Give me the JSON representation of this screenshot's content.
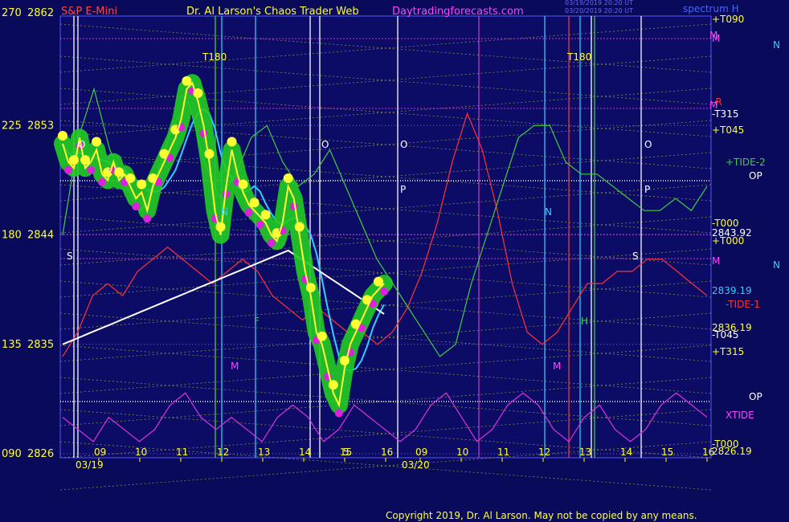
{
  "header": {
    "instrument": "S&P E-Mini",
    "title": "Dr. Al Larson's Chaos Trader Web",
    "site": "Daytradingforecasts.com",
    "stamp1": "03/19/2019 20:20 UT",
    "stamp2": "03/20/2019 20:20 UT",
    "spectrum": "spectrum H"
  },
  "footer": {
    "copyright": "Copyright 2019, Dr. Al Larson. May not be copied by any means."
  },
  "colors": {
    "bg": "#0a0a5a",
    "plot_bg": "#0c0c66",
    "price": "#ffff33",
    "green_tube": "#22cc22",
    "magenta": "#dd22dd",
    "cyan_avg": "#33ccff",
    "white_avg": "#ffffff",
    "tide1": "#ff3333",
    "tide2": "#44cc44",
    "xtide": "#dd33dd"
  },
  "chart_data": {
    "type": "line",
    "title": "S&P E-Mini",
    "left_axis_degrees": [
      "270",
      "225",
      "180",
      "135",
      "090"
    ],
    "left_axis_prices": [
      "2862",
      "2853",
      "2844",
      "2835",
      "2826"
    ],
    "ylim": [
      2826,
      2862
    ],
    "date_labels": [
      "03/19",
      "03/20"
    ],
    "hour_labels": [
      "09",
      "10",
      "11",
      "12",
      "13",
      "14",
      "15",
      "16",
      "09",
      "10",
      "11",
      "12",
      "13",
      "14",
      "15",
      "16"
    ],
    "right_labels": [
      "+T090",
      "M",
      "N",
      "-R",
      "-T315",
      "+T045",
      "+TIDE-2",
      "OP",
      "-T000",
      "2843.92",
      "+T000",
      "M",
      "N",
      "2839.19",
      "-TIDE-1",
      "2836.19",
      "-T045",
      "+T315",
      "OP",
      "XTIDE",
      "-T000",
      "2826.19"
    ],
    "annotations": [
      "T180",
      "T180",
      "O",
      "O",
      "O",
      "O",
      "P",
      "P",
      "S",
      "S",
      "N",
      "N",
      "F",
      "H",
      "M",
      "M",
      "M",
      "M",
      "5"
    ],
    "series": [
      {
        "name": "S&P E-Mini",
        "x": [
          0,
          1,
          2,
          3,
          4,
          5,
          6,
          7,
          8,
          9,
          10,
          11,
          12,
          13,
          14,
          15,
          16,
          17,
          18,
          19,
          20,
          21,
          22,
          23,
          24,
          25,
          26,
          27,
          28,
          29,
          30,
          31,
          32,
          33,
          34,
          35,
          36,
          37,
          38,
          39,
          40,
          41,
          42,
          43,
          44,
          45,
          46,
          47,
          48,
          49,
          50,
          51,
          52,
          53,
          54,
          55,
          56,
          57
        ],
        "values": [
          2851.5,
          2850,
          2849.5,
          2852,
          2849.5,
          2850,
          2851,
          2849,
          2848.5,
          2850,
          2848.5,
          2849,
          2848,
          2847,
          2847.5,
          2846,
          2848,
          2849,
          2850,
          2851,
          2852,
          2853.5,
          2856,
          2856.5,
          2855,
          2853,
          2850,
          2846,
          2844,
          2848,
          2851,
          2849,
          2847.5,
          2846.5,
          2846,
          2845.5,
          2845,
          2844,
          2843.5,
          2845,
          2848,
          2847,
          2844,
          2841,
          2839,
          2836,
          2835,
          2833,
          2831,
          2830,
          2833,
          2835,
          2836,
          2837,
          2838,
          2839,
          2839.5,
          2840
        ]
      },
      {
        "name": "+TIDE-2",
        "values": [
          2844,
          2852,
          2856,
          2851,
          2848,
          2846,
          2849,
          2853,
          2855,
          2850,
          2847,
          2849,
          2852,
          2853,
          2850,
          2848,
          2849,
          2851,
          2848,
          2845,
          2842,
          2840,
          2838,
          2836,
          2834,
          2835,
          2840,
          2844,
          2848,
          2852,
          2853,
          2853,
          2850,
          2849,
          2849,
          2848,
          2847,
          2846,
          2846,
          2847,
          2846,
          2848
        ]
      },
      {
        "name": "-TIDE-1",
        "values": [
          2834,
          2836,
          2839,
          2840,
          2839,
          2841,
          2842,
          2843,
          2842,
          2841,
          2840,
          2841,
          2842,
          2841,
          2839,
          2838,
          2837,
          2838,
          2837,
          2836,
          2836,
          2835,
          2836,
          2838,
          2841,
          2845,
          2850,
          2854,
          2851,
          2846,
          2840,
          2836,
          2835,
          2836,
          2838,
          2840,
          2840,
          2841,
          2841,
          2842,
          2842,
          2841,
          2840,
          2839
        ]
      },
      {
        "name": "XTIDE",
        "values": [
          2829,
          2828,
          2827,
          2829,
          2828,
          2827,
          2828,
          2830,
          2831,
          2829,
          2828,
          2829,
          2828,
          2827,
          2829,
          2830,
          2829,
          2827,
          2828,
          2830,
          2829,
          2828,
          2827,
          2828,
          2830,
          2831,
          2829,
          2827,
          2828,
          2830,
          2831,
          2830,
          2828,
          2827,
          2829,
          2830,
          2828,
          2827,
          2828,
          2830,
          2831,
          2830,
          2829
        ]
      }
    ]
  }
}
